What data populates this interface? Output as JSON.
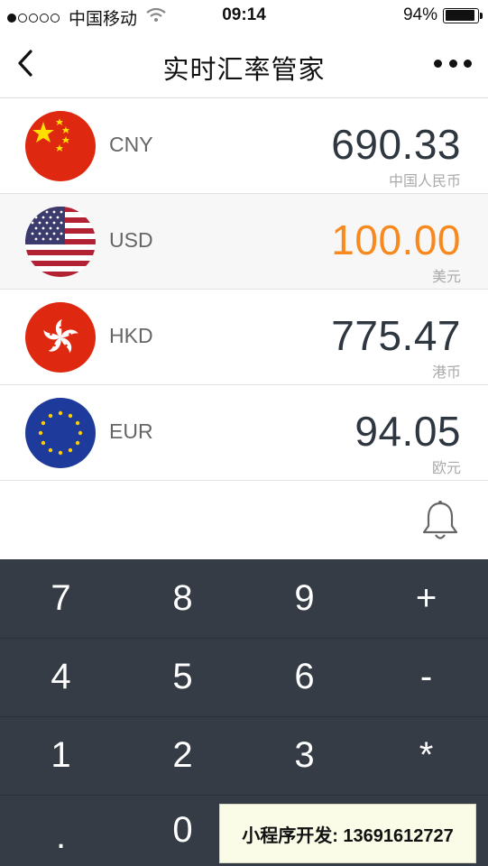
{
  "status_bar": {
    "carrier": "中国移动",
    "time": "09:14",
    "battery_text": "94%",
    "battery_level": 0.94,
    "signal_bars": 1
  },
  "nav": {
    "title": "实时汇率管家",
    "back_icon": "chevron-left-icon",
    "more_icon": "more-horizontal-icon"
  },
  "currencies": [
    {
      "code": "CNY",
      "amount": "690.33",
      "name": "中国人民币",
      "flag_icon": "china-flag-icon",
      "active": false
    },
    {
      "code": "USD",
      "amount": "100.00",
      "name": "美元",
      "flag_icon": "usa-flag-icon",
      "active": true
    },
    {
      "code": "HKD",
      "amount": "775.47",
      "name": "港币",
      "flag_icon": "hong-kong-flag-icon",
      "active": false
    },
    {
      "code": "EUR",
      "amount": "94.05",
      "name": "欧元",
      "flag_icon": "eu-flag-icon",
      "active": false
    }
  ],
  "colors": {
    "active_amount": "#f7891e",
    "keypad_bg": "#353c45"
  },
  "keypad": {
    "keys": [
      [
        "7",
        "8",
        "9",
        "+"
      ],
      [
        "4",
        "5",
        "6",
        "-"
      ],
      [
        "1",
        "2",
        "3",
        "*"
      ],
      [
        ".",
        "0"
      ]
    ]
  },
  "banner": {
    "text": "小程序开发: 13691612727"
  }
}
